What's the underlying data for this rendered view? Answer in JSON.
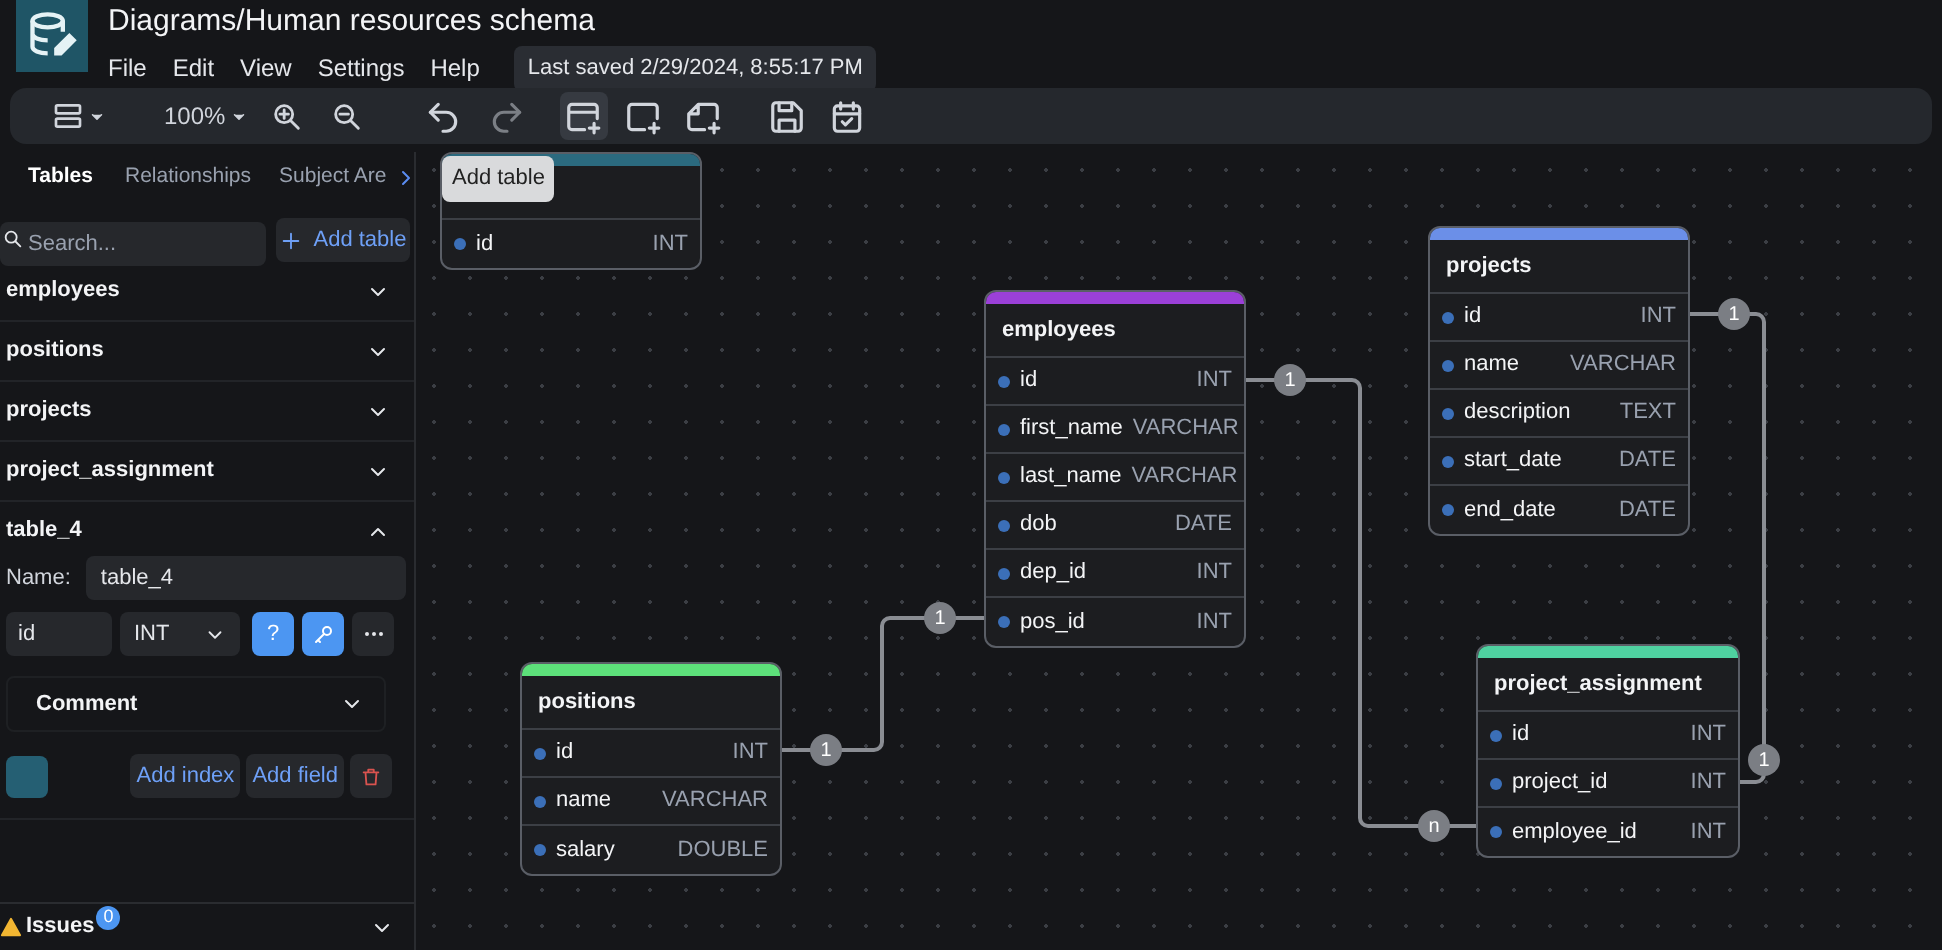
{
  "app": {
    "title": "Diagrams/Human resources schema",
    "menu": [
      "File",
      "Edit",
      "View",
      "Settings",
      "Help"
    ],
    "last_saved": "Last saved 2/29/2024, 8:55:17 PM"
  },
  "toolbar": {
    "zoom": "100%",
    "tooltip": "Add table"
  },
  "sidebar": {
    "tabs": [
      {
        "label": "Tables",
        "selected": true
      },
      {
        "label": "Relationships",
        "selected": false
      },
      {
        "label": "Subject Are",
        "selected": false
      }
    ],
    "search": {
      "placeholder": "Search..."
    },
    "add_table": "Add table",
    "tables": [
      {
        "name": "employees",
        "expanded": false
      },
      {
        "name": "positions",
        "expanded": false
      },
      {
        "name": "projects",
        "expanded": false
      },
      {
        "name": "project_assignment",
        "expanded": false
      },
      {
        "name": "table_4",
        "expanded": true
      }
    ],
    "editor": {
      "name_label": "Name:",
      "name_value": "table_4",
      "field": {
        "name": "id",
        "type": "INT",
        "nullable_label": "?",
        "not_null": true,
        "primary": true
      },
      "comment": "Comment",
      "color": "#255f73",
      "add_index": "Add index",
      "add_field": "Add field"
    },
    "issues": {
      "label": "Issues",
      "count": "0"
    }
  },
  "diagram": {
    "tables": [
      {
        "color": "#2b6a7f",
        "fields": [
          {
            "name": "id",
            "type": "INT"
          }
        ]
      },
      {
        "name": "employees",
        "color": "#9b40d8",
        "fields": [
          {
            "name": "id",
            "type": "INT"
          },
          {
            "name": "first_name",
            "type": "VARCHAR"
          },
          {
            "name": "last_name",
            "type": "VARCHAR"
          },
          {
            "name": "dob",
            "type": "DATE"
          },
          {
            "name": "dep_id",
            "type": "INT"
          },
          {
            "name": "pos_id",
            "type": "INT"
          }
        ]
      },
      {
        "name": "projects",
        "color": "#6b8fe8",
        "fields": [
          {
            "name": "id",
            "type": "INT"
          },
          {
            "name": "name",
            "type": "VARCHAR"
          },
          {
            "name": "description",
            "type": "TEXT"
          },
          {
            "name": "start_date",
            "type": "DATE"
          },
          {
            "name": "end_date",
            "type": "DATE"
          }
        ]
      },
      {
        "name": "project_assignment",
        "color": "#4fd1a0",
        "fields": [
          {
            "name": "id",
            "type": "INT"
          },
          {
            "name": "project_id",
            "type": "INT"
          },
          {
            "name": "employee_id",
            "type": "INT"
          }
        ]
      },
      {
        "name": "positions",
        "color": "#5de07a",
        "fields": [
          {
            "name": "id",
            "type": "INT"
          },
          {
            "name": "name",
            "type": "VARCHAR"
          },
          {
            "name": "salary",
            "type": "DOUBLE"
          }
        ]
      }
    ],
    "relationships": [
      {
        "from_cardinality": "1",
        "to_cardinality": "n"
      },
      {
        "from_cardinality": "1",
        "to_cardinality": "1"
      },
      {
        "from_cardinality": "1",
        "to_cardinality": "1"
      }
    ]
  }
}
